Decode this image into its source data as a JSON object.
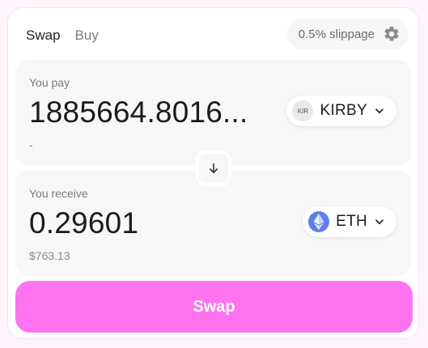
{
  "tabs": [
    {
      "label": "Swap",
      "active": true
    },
    {
      "label": "Buy",
      "active": false
    }
  ],
  "settings": {
    "slippage_label": "0.5% slippage",
    "icon": "gear-icon"
  },
  "pay": {
    "label": "You pay",
    "amount": "1885664.8016...",
    "fiat": "-",
    "token": {
      "symbol": "KIRBY",
      "logo_text": "KIR",
      "icon": "chevron-down-icon"
    }
  },
  "switch": {
    "icon": "arrow-down-icon"
  },
  "receive": {
    "label": "You receive",
    "amount": "0.29601",
    "fiat": "$763.13",
    "token": {
      "symbol": "ETH",
      "icon": "chevron-down-icon"
    }
  },
  "action": {
    "label": "Swap"
  },
  "colors": {
    "accent": "#ff73f0",
    "eth": "#627eea",
    "panel": "#f7f7f7"
  }
}
